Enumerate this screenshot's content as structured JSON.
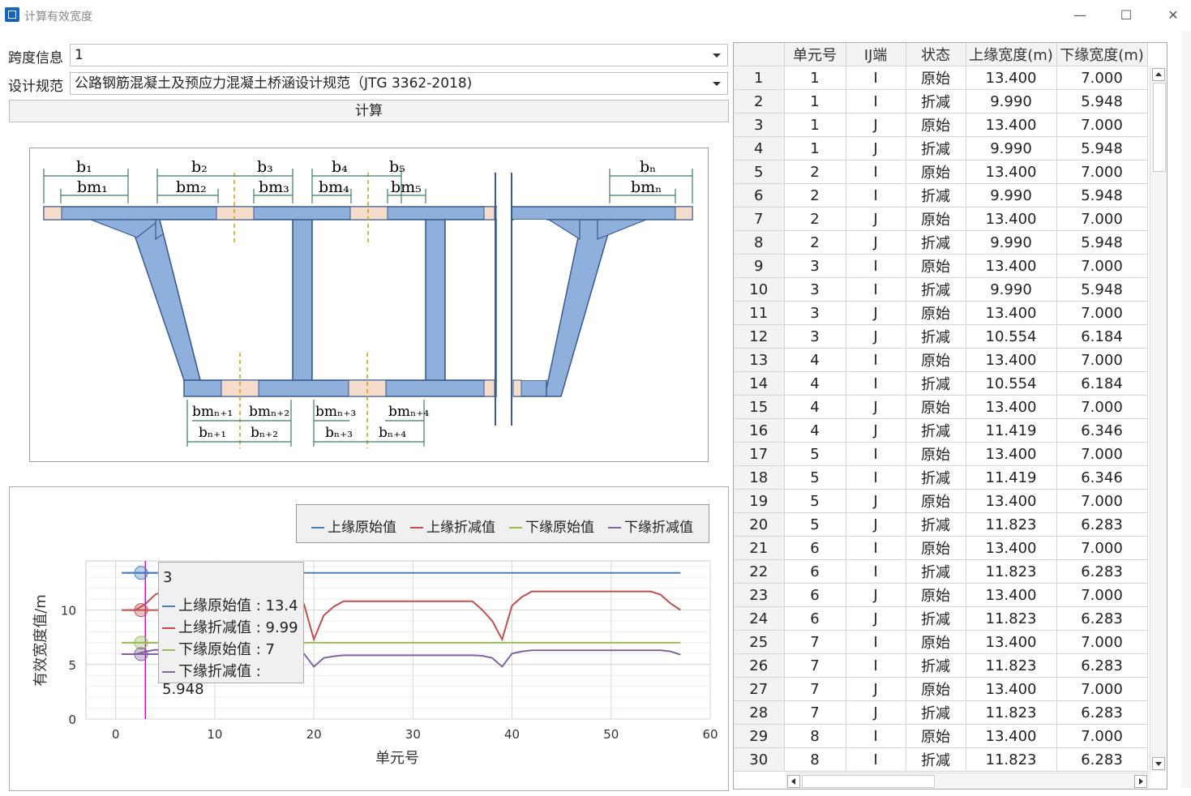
{
  "window": {
    "title": "计算有效宽度",
    "minimize": "—",
    "maximize": "☐",
    "close": "✕"
  },
  "form": {
    "span_label": "跨度信息",
    "span_value": "1",
    "code_label": "设计规范",
    "code_value": "公路钢筋混凝土及预应力混凝土桥涵设计规范（JTG 3362-2018)",
    "calc_button": "计算"
  },
  "diagram": {
    "top_labels": [
      "b₁",
      "b₂",
      "b₃",
      "b₄",
      "b₅",
      "bₙ"
    ],
    "top_m_labels": [
      "bm₁",
      "bm₂",
      "bm₃",
      "bm₄",
      "bm₅",
      "bmₙ"
    ],
    "bottom_m_labels": [
      "bmₙ₊₁",
      "bmₙ₊₂",
      "bmₙ₊₃",
      "bmₙ₊₄"
    ],
    "bottom_labels": [
      "bₙ₊₁",
      "bₙ₊₂",
      "bₙ₊₃",
      "bₙ₊₄"
    ],
    "colors": {
      "concrete": "#8fb0dd",
      "edge": "#3a5a8c",
      "flange_mark": "#f5dccb",
      "axis_dash": "#c8a015",
      "dim": "#3f7a6a"
    }
  },
  "chart_data": {
    "type": "line",
    "xlabel": "单元号",
    "ylabel": "有效宽度值/m",
    "xlim": [
      -3,
      60
    ],
    "ylim": [
      0,
      14.5
    ],
    "xticks": [
      0,
      10,
      20,
      30,
      40,
      50,
      60
    ],
    "yticks": [
      0,
      5,
      10
    ],
    "grid": true,
    "legend": "top-right",
    "x": [
      1,
      2,
      3,
      4,
      5,
      6,
      7,
      8,
      9,
      10,
      11,
      12,
      13,
      14,
      15,
      16,
      17,
      18,
      19,
      20,
      21,
      22,
      23,
      24,
      25,
      26,
      27,
      28,
      29,
      30,
      31,
      32,
      33,
      34,
      35,
      36,
      37,
      38,
      39,
      40,
      41,
      42,
      43,
      44,
      45,
      46,
      47,
      48,
      49,
      50,
      51,
      52,
      53,
      54,
      55,
      56,
      57
    ],
    "series": [
      {
        "name": "上缘原始值",
        "color": "#4a7ebb",
        "values": [
          13.4,
          13.4,
          13.4,
          13.4,
          13.4,
          13.4,
          13.4,
          13.4,
          13.4,
          13.4,
          13.4,
          13.4,
          13.4,
          13.4,
          13.4,
          13.4,
          13.4,
          13.4,
          13.4,
          13.4,
          13.4,
          13.4,
          13.4,
          13.4,
          13.4,
          13.4,
          13.4,
          13.4,
          13.4,
          13.4,
          13.4,
          13.4,
          13.4,
          13.4,
          13.4,
          13.4,
          13.4,
          13.4,
          13.4,
          13.4,
          13.4,
          13.4,
          13.4,
          13.4,
          13.4,
          13.4,
          13.4,
          13.4,
          13.4,
          13.4,
          13.4,
          13.4,
          13.4,
          13.4,
          13.4,
          13.4,
          13.4
        ]
      },
      {
        "name": "上缘折减值",
        "color": "#c0504d",
        "values": [
          9.99,
          9.99,
          10.554,
          11.419,
          11.823,
          11.823,
          11.823,
          11.823,
          11.823,
          11.823,
          11.823,
          11.823,
          11.823,
          11.823,
          11.823,
          11.823,
          11.823,
          11.823,
          10.554,
          7.3,
          9.5,
          10.3,
          10.8,
          10.8,
          10.8,
          10.8,
          10.8,
          10.8,
          10.8,
          10.8,
          10.8,
          10.8,
          10.8,
          10.8,
          10.8,
          10.8,
          10.0,
          9.0,
          7.3,
          10.4,
          11.2,
          11.7,
          11.7,
          11.7,
          11.7,
          11.7,
          11.7,
          11.7,
          11.7,
          11.7,
          11.7,
          11.7,
          11.7,
          11.7,
          11.4,
          10.6,
          10.0
        ]
      },
      {
        "name": "下缘原始值",
        "color": "#9bbb59",
        "values": [
          7,
          7,
          7,
          7,
          7,
          7,
          7,
          7,
          7,
          7,
          7,
          7,
          7,
          7,
          7,
          7,
          7,
          7,
          7,
          7,
          7,
          7,
          7,
          7,
          7,
          7,
          7,
          7,
          7,
          7,
          7,
          7,
          7,
          7,
          7,
          7,
          7,
          7,
          7,
          7,
          7,
          7,
          7,
          7,
          7,
          7,
          7,
          7,
          7,
          7,
          7,
          7,
          7,
          7,
          7,
          7,
          7
        ]
      },
      {
        "name": "下缘折减值",
        "color": "#8064a2",
        "values": [
          5.948,
          5.948,
          6.184,
          6.346,
          6.283,
          6.283,
          6.283,
          6.283,
          6.283,
          6.283,
          6.283,
          6.283,
          6.283,
          6.283,
          6.283,
          6.283,
          6.283,
          6.283,
          6.0,
          4.8,
          5.6,
          5.75,
          5.85,
          5.85,
          5.85,
          5.85,
          5.85,
          5.85,
          5.85,
          5.85,
          5.85,
          5.85,
          5.85,
          5.85,
          5.85,
          5.85,
          5.8,
          5.6,
          4.8,
          6.0,
          6.2,
          6.3,
          6.3,
          6.3,
          6.3,
          6.3,
          6.3,
          6.3,
          6.3,
          6.3,
          6.3,
          6.3,
          6.3,
          6.3,
          6.3,
          6.2,
          5.9
        ]
      }
    ],
    "cursor_x": 3,
    "tooltip": {
      "title": "3",
      "rows": [
        "上缘原始值 : 13.4",
        "上缘折减值 : 9.99",
        "下缘原始值 : 7",
        "下缘折减值 : 5.948"
      ]
    }
  },
  "grid": {
    "headers": [
      "",
      "单元号",
      "IJ端",
      "状态",
      "上缘宽度(m)",
      "下缘宽度(m)"
    ],
    "rows": [
      [
        "1",
        "1",
        "I",
        "原始",
        "13.400",
        "7.000"
      ],
      [
        "2",
        "1",
        "I",
        "折减",
        "9.990",
        "5.948"
      ],
      [
        "3",
        "1",
        "J",
        "原始",
        "13.400",
        "7.000"
      ],
      [
        "4",
        "1",
        "J",
        "折减",
        "9.990",
        "5.948"
      ],
      [
        "5",
        "2",
        "I",
        "原始",
        "13.400",
        "7.000"
      ],
      [
        "6",
        "2",
        "I",
        "折减",
        "9.990",
        "5.948"
      ],
      [
        "7",
        "2",
        "J",
        "原始",
        "13.400",
        "7.000"
      ],
      [
        "8",
        "2",
        "J",
        "折减",
        "9.990",
        "5.948"
      ],
      [
        "9",
        "3",
        "I",
        "原始",
        "13.400",
        "7.000"
      ],
      [
        "10",
        "3",
        "I",
        "折减",
        "9.990",
        "5.948"
      ],
      [
        "11",
        "3",
        "J",
        "原始",
        "13.400",
        "7.000"
      ],
      [
        "12",
        "3",
        "J",
        "折减",
        "10.554",
        "6.184"
      ],
      [
        "13",
        "4",
        "I",
        "原始",
        "13.400",
        "7.000"
      ],
      [
        "14",
        "4",
        "I",
        "折减",
        "10.554",
        "6.184"
      ],
      [
        "15",
        "4",
        "J",
        "原始",
        "13.400",
        "7.000"
      ],
      [
        "16",
        "4",
        "J",
        "折减",
        "11.419",
        "6.346"
      ],
      [
        "17",
        "5",
        "I",
        "原始",
        "13.400",
        "7.000"
      ],
      [
        "18",
        "5",
        "I",
        "折减",
        "11.419",
        "6.346"
      ],
      [
        "19",
        "5",
        "J",
        "原始",
        "13.400",
        "7.000"
      ],
      [
        "20",
        "5",
        "J",
        "折减",
        "11.823",
        "6.283"
      ],
      [
        "21",
        "6",
        "I",
        "原始",
        "13.400",
        "7.000"
      ],
      [
        "22",
        "6",
        "I",
        "折减",
        "11.823",
        "6.283"
      ],
      [
        "23",
        "6",
        "J",
        "原始",
        "13.400",
        "7.000"
      ],
      [
        "24",
        "6",
        "J",
        "折减",
        "11.823",
        "6.283"
      ],
      [
        "25",
        "7",
        "I",
        "原始",
        "13.400",
        "7.000"
      ],
      [
        "26",
        "7",
        "I",
        "折减",
        "11.823",
        "6.283"
      ],
      [
        "27",
        "7",
        "J",
        "原始",
        "13.400",
        "7.000"
      ],
      [
        "28",
        "7",
        "J",
        "折减",
        "11.823",
        "6.283"
      ],
      [
        "29",
        "8",
        "I",
        "原始",
        "13.400",
        "7.000"
      ],
      [
        "30",
        "8",
        "I",
        "折减",
        "11.823",
        "6.283"
      ]
    ]
  }
}
